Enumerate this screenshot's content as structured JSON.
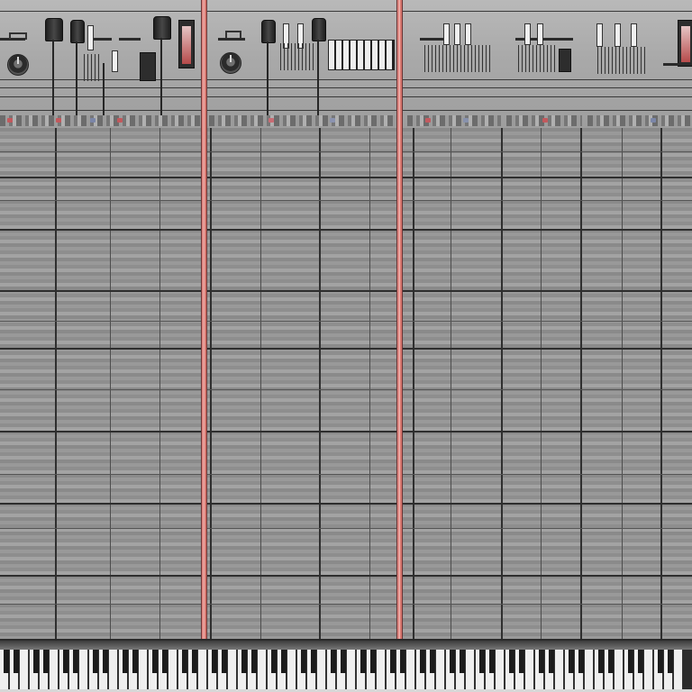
{
  "window": {
    "title": ""
  },
  "device_strip": {
    "modules": [
      {
        "name": "module-1",
        "accents": [
          "#c2595d",
          "#7b86a8",
          "#c2595d"
        ]
      },
      {
        "name": "module-2",
        "accents": [
          "#c96b73",
          "#8b93b0"
        ]
      },
      {
        "name": "module-3",
        "accents": [
          "#c45b60",
          "#8892ad",
          "#c45b60"
        ]
      },
      {
        "name": "module-4",
        "accents": [
          "#c2595d"
        ]
      },
      {
        "name": "module-5",
        "accents": [
          "#7b86a8"
        ]
      }
    ],
    "icons": [
      "jack-knob-icon",
      "patch-plug-icon",
      "mini-keyboard-icon",
      "fader-icon",
      "slider-icon"
    ]
  },
  "grid": {
    "playhead_markers": 2,
    "marker_color": "#e08a85",
    "line_color": "#2f2f2f",
    "background_color": "#8e8e8e"
  },
  "keyboard": {
    "icon": "piano-keyboard-icon"
  }
}
